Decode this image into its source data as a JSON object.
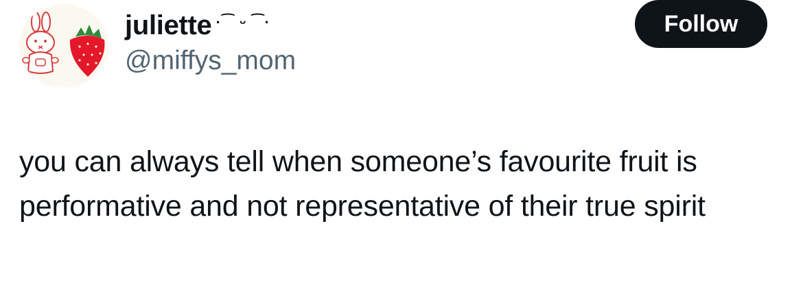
{
  "tweet": {
    "author": {
      "display_name": "juliette",
      "name_decoration": "·⁀ ᵕ ⁀·",
      "handle": "@miffys_mom",
      "avatar_icon": "miffy-and-strawberry-avatar"
    },
    "follow_label": "Follow",
    "text": "you can always tell when someone’s favourite fruit is performative and not representative of their true spirit"
  },
  "colors": {
    "text_primary": "#0f1419",
    "text_secondary": "#536471",
    "follow_bg": "#0f1419",
    "follow_text": "#ffffff",
    "background": "#ffffff"
  }
}
